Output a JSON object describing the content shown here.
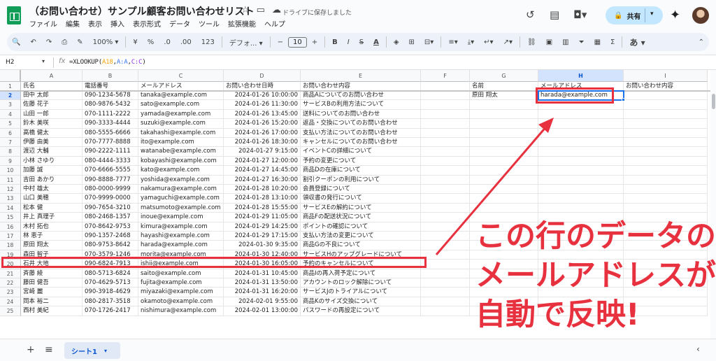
{
  "header": {
    "title": "（お問い合わせ）サンプル顧客お問い合わせリスト",
    "saved_status": "ドライブに保存しました",
    "menu": [
      "ファイル",
      "編集",
      "表示",
      "挿入",
      "表示形式",
      "データ",
      "ツール",
      "拡張機能",
      "ヘルプ"
    ],
    "share_label": "共有"
  },
  "toolbar": {
    "zoom": "100%",
    "percent": "%",
    "decimal_dec": ".0",
    "decimal_inc": ".00",
    "number_format": "123",
    "font": "デフォ...",
    "font_size": "10",
    "bold": "B",
    "italic": "I",
    "strike": "S",
    "text_color": "A",
    "input_tools": "あ"
  },
  "formula_bar": {
    "cell_ref": "H2",
    "formula_prefix": "=XLOOKUP(",
    "formula_arg1": "A18",
    "formula_mid1": ",",
    "formula_arg2": "A:A",
    "formula_mid2": ",",
    "formula_arg3": "C:C",
    "formula_suffix": ")"
  },
  "columns": [
    "A",
    "B",
    "C",
    "D",
    "E",
    "F",
    "G",
    "H",
    "I"
  ],
  "headers": [
    "氏名",
    "電話番号",
    "メールアドレス",
    "お問い合わせ日時",
    "お問い合わせ内容",
    "",
    "名前",
    "メールアドレス",
    "お問い合わせ内容"
  ],
  "rows": [
    [
      "田中 太郎",
      "090-1234-5678",
      "tanaka@example.com",
      "2024-01-26 10:00:00",
      "商品Aについてのお問い合わせ"
    ],
    [
      "佐藤 花子",
      "080-9876-5432",
      "sato@example.com",
      "2024-01-26 11:30:00",
      "サービスBの利用方法について"
    ],
    [
      "山田 一郎",
      "070-1111-2222",
      "yamada@example.com",
      "2024-01-26 13:45:00",
      "送料についてのお問い合わせ"
    ],
    [
      "鈴木 美咲",
      "090-3333-4444",
      "suzuki@example.com",
      "2024-01-26 15:20:00",
      "返品・交換についてのお問い合わせ"
    ],
    [
      "高橋 健太",
      "080-5555-6666",
      "takahashi@example.com",
      "2024-01-26 17:00:00",
      "支払い方法についてのお問い合わせ"
    ],
    [
      "伊藤 由美",
      "070-7777-8888",
      "ito@example.com",
      "2024-01-26 18:30:00",
      "キャンセルについてのお問い合わせ"
    ],
    [
      "渡辺 大輔",
      "090-2222-1111",
      "watanabe@example.com",
      "2024-01-27 9:15:00",
      "イベントCの詳細について"
    ],
    [
      "小林 さゆり",
      "080-4444-3333",
      "kobayashi@example.com",
      "2024-01-27 12:00:00",
      "予約の変更について"
    ],
    [
      "加藤 誠",
      "070-6666-5555",
      "kato@example.com",
      "2024-01-27 14:45:00",
      "商品Dの在庫について"
    ],
    [
      "吉田 あかり",
      "090-8888-7777",
      "yoshida@example.com",
      "2024-01-27 16:30:00",
      "割引クーポンの利用について"
    ],
    [
      "中村 雄太",
      "080-0000-9999",
      "nakamura@example.com",
      "2024-01-28 10:20:00",
      "会員登録について"
    ],
    [
      "山口 美穂",
      "070-9999-0000",
      "yamaguchi@example.com",
      "2024-01-28 13:10:00",
      "領収書の発行について"
    ],
    [
      "松本 健",
      "090-7654-3210",
      "matsumoto@example.com",
      "2024-01-28 15:55:00",
      "サービスEの解約について"
    ],
    [
      "井上 真理子",
      "080-2468-1357",
      "inoue@example.com",
      "2024-01-29 11:05:00",
      "商品Fの配送状況について"
    ],
    [
      "木村 拓也",
      "070-8642-9753",
      "kimura@example.com",
      "2024-01-29 14:25:00",
      "ポイントの確認について"
    ],
    [
      "林 恵子",
      "090-1357-2468",
      "hayashi@example.com",
      "2024-01-29 17:15:00",
      "支払い方法の変更について"
    ],
    [
      "原田 翔太",
      "080-9753-8642",
      "harada@example.com",
      "2024-01-30 9:35:00",
      "商品Gの不良について"
    ],
    [
      "森田 智子",
      "070-3579-1246",
      "morita@example.com",
      "2024-01-30 12:40:00",
      "サービスHのアップグレードについて"
    ],
    [
      "石井 大地",
      "090-6824-7913",
      "ishii@example.com",
      "2024-01-30 16:05:00",
      "予約のキャンセルについて"
    ],
    [
      "斉藤 綾",
      "080-5713-6824",
      "saito@example.com",
      "2024-01-31 10:45:00",
      "商品Iの再入荷予定について"
    ],
    [
      "藤田 健吾",
      "070-4629-5713",
      "fujita@example.com",
      "2024-01-31 13:50:00",
      "アカウントのロック解除について"
    ],
    [
      "宮崎 麗",
      "090-3918-4629",
      "miyazaki@example.com",
      "2024-01-31 16:20:00",
      "サービスJのトライアルについて"
    ],
    [
      "岡本 裕二",
      "080-2817-3518",
      "okamoto@example.com",
      "2024-02-01 9:55:00",
      "商品Kのサイズ交換について"
    ],
    [
      "西村 美紀",
      "070-1726-2417",
      "nishimura@example.com",
      "2024-02-01 13:00:00",
      "パスワードの再設定について"
    ]
  ],
  "lookup": {
    "name": "原田 翔太",
    "email": "harada@example.com"
  },
  "row_numbers": [
    "1",
    "2",
    "3",
    "4",
    "5",
    "6",
    "7",
    "8",
    "9",
    "10",
    "11",
    "12",
    "13",
    "14",
    "15",
    "16",
    "17",
    "18",
    "19",
    "20",
    "21",
    "22",
    "23",
    "24",
    "25"
  ],
  "sheetbar": {
    "sheet_name": "シート1"
  },
  "callout": {
    "line1": "この行のデータの",
    "line2": "メールアドレスが",
    "line3": "自動で反映!"
  },
  "colors": {
    "accent": "#1a73e8",
    "annotation": "#e8313f",
    "share_bg": "#c2e7ff",
    "sheets_green": "#0f9d58"
  }
}
